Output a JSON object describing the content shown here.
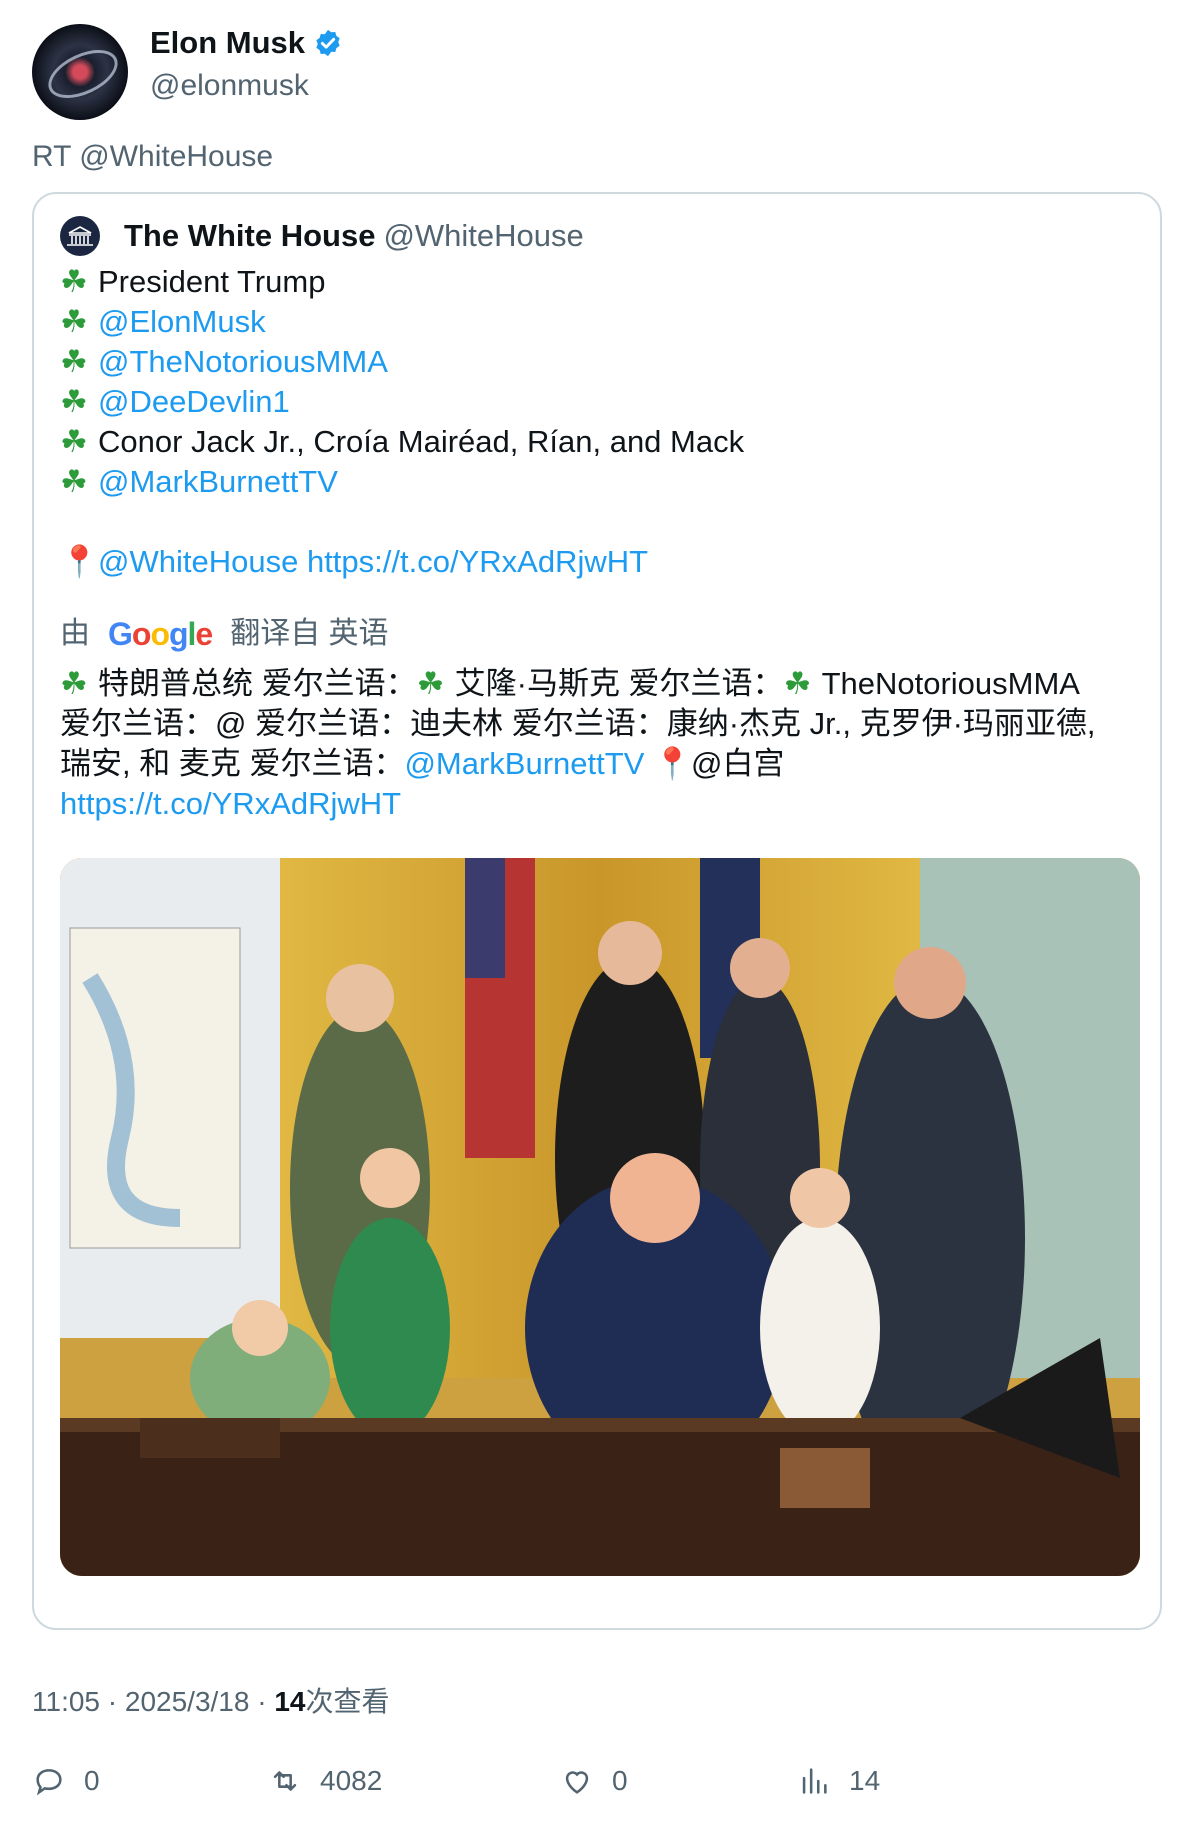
{
  "author": {
    "name": "Elon Musk",
    "handle": "@elonmusk",
    "verified": true
  },
  "retweet_label": "RT @WhiteHouse",
  "quoted": {
    "name": "The White House",
    "handle": "@WhiteHouse",
    "lines": [
      {
        "icon": "clover-icon",
        "text": "President Trump",
        "is_link": false
      },
      {
        "icon": "clover-icon",
        "text": "@ElonMusk",
        "is_link": true
      },
      {
        "icon": "clover-icon",
        "text": "@TheNotoriousMMA",
        "is_link": true
      },
      {
        "icon": "clover-icon",
        "text": "@DeeDevlin1",
        "is_link": true
      },
      {
        "icon": "clover-icon",
        "text": "Conor Jack Jr., Croía Mairéad, Rían, and Mack",
        "is_link": false
      },
      {
        "icon": "clover-icon",
        "text": "@MarkBurnettTV",
        "is_link": true
      }
    ],
    "location_mention": "@WhiteHouse",
    "location_url": "https://t.co/YRxAdRjwHT",
    "translation": {
      "by_prefix": "由",
      "provider": "Google",
      "suffix": "翻译自 英语",
      "line1": "特朗普总统 爱尔兰语：",
      "line1b": "艾隆·马斯克 爱尔兰语：",
      "line1c": "TheNotoriousMMA",
      "line2": "爱尔兰语：@ 爱尔兰语：迪夫林 爱尔兰语：康纳·杰克 Jr., 克罗伊·玛丽亚德,",
      "line3a": "瑞安, 和 麦克 爱尔兰语：",
      "line3_link": "@MarkBurnettTV",
      "line3b": "@白宫",
      "line4_link": "https://t.co/YRxAdRjwHT"
    }
  },
  "meta": {
    "time": "11:05 · 2025/3/18 · ",
    "views_count": "14",
    "views_label": "次查看"
  },
  "actions": {
    "replies": "0",
    "retweets": "4082",
    "likes": "0",
    "views": "14"
  },
  "colors": {
    "link": "#1d9bf0",
    "secondary_text": "#536471",
    "border": "#cfd9de",
    "verified": "#1d9bf0"
  }
}
